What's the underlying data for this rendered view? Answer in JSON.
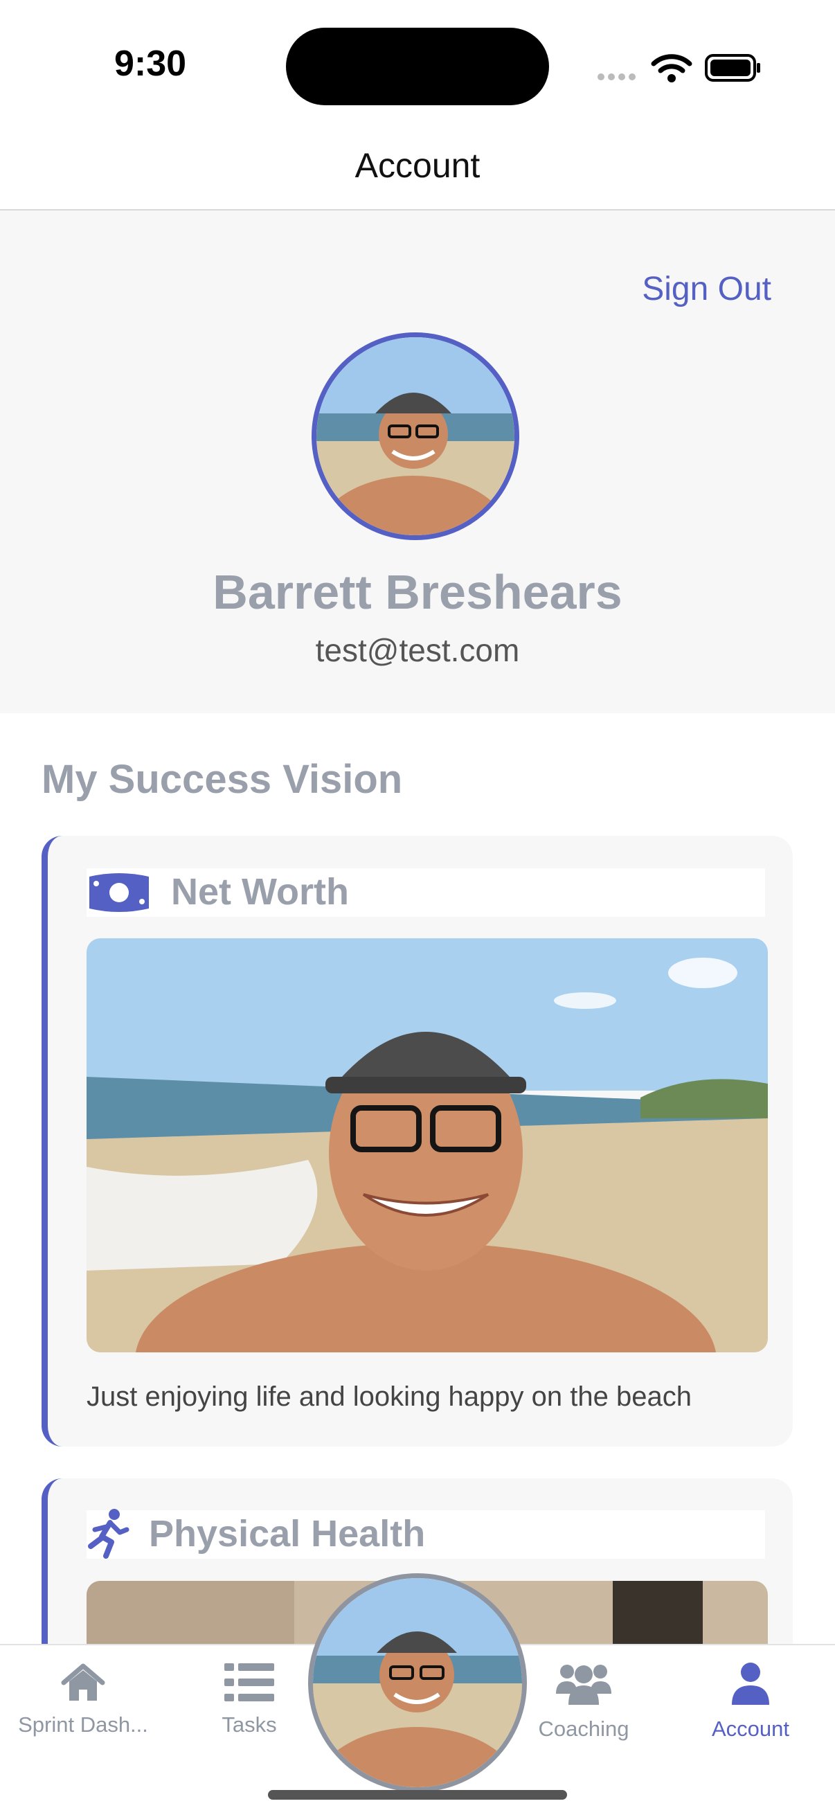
{
  "status": {
    "time": "9:30"
  },
  "nav": {
    "title": "Account"
  },
  "profile": {
    "sign_out": "Sign Out",
    "name": "Barrett Breshears",
    "email": "test@test.com"
  },
  "vision": {
    "title": "My Success Vision",
    "cards": [
      {
        "title": "Net Worth",
        "icon": "money-bill-icon",
        "caption": "Just enjoying life and looking happy on the beach"
      },
      {
        "title": "Physical Health",
        "icon": "running-person-icon"
      }
    ]
  },
  "tabs": [
    {
      "label": "Sprint Dash...",
      "icon": "home-icon"
    },
    {
      "label": "Tasks",
      "icon": "list-icon"
    },
    {
      "label": "Coaching",
      "icon": "users-icon"
    },
    {
      "label": "Account",
      "icon": "person-icon",
      "active": true
    }
  ],
  "colors": {
    "accent": "#5560c4",
    "muted": "#9aa0ab",
    "background": "#f7f7f7"
  }
}
